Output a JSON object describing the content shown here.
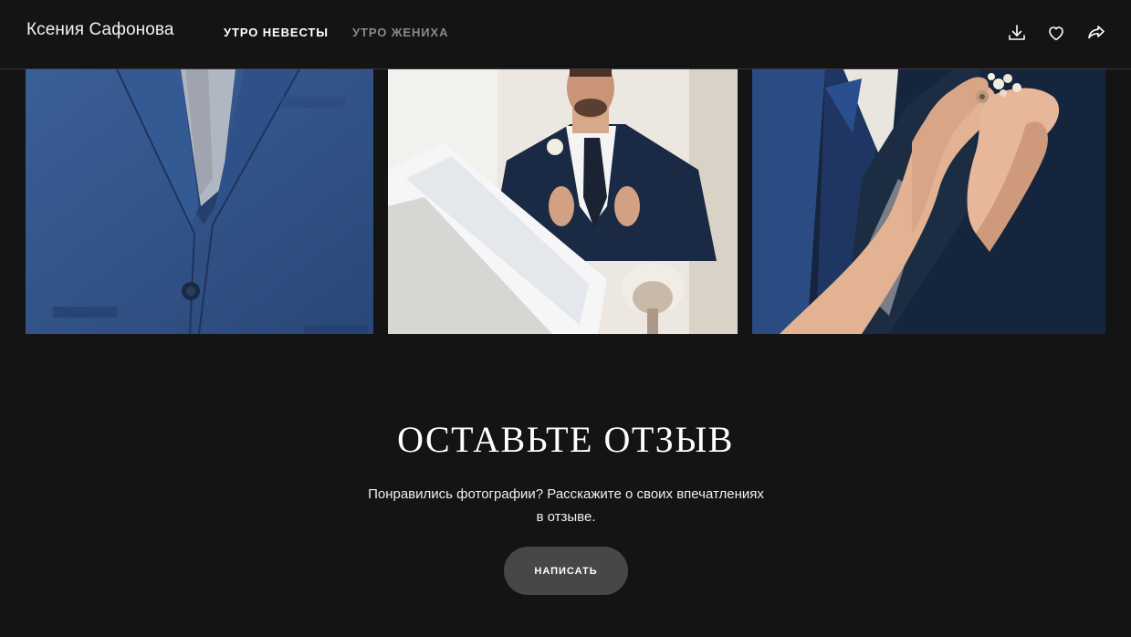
{
  "header": {
    "brand": "Ксения Сафонова",
    "tabs": [
      {
        "label": "УТРО НЕВЕСТЫ",
        "active": true
      },
      {
        "label": "УТРО ЖЕНИХА",
        "active": false
      }
    ],
    "actions": [
      "download-icon",
      "heart-icon",
      "share-icon"
    ]
  },
  "gallery": {
    "photos": [
      {
        "subject": "navy suit jacket with grey vest close-up"
      },
      {
        "subject": "groom adjusting tie in front of mirror"
      },
      {
        "subject": "hands pinning boutonniere on groom's lapel"
      }
    ]
  },
  "review": {
    "title": "ОСТАВЬТЕ ОТЗЫВ",
    "text_line1": "Понравились фотографии? Расскажите о своих впечатлениях",
    "text_line2": "в отзыве.",
    "button": "НАПИСАТЬ"
  },
  "colors": {
    "background": "#141414",
    "button": "#474747",
    "inactive_tab": "#8a8a8a"
  }
}
